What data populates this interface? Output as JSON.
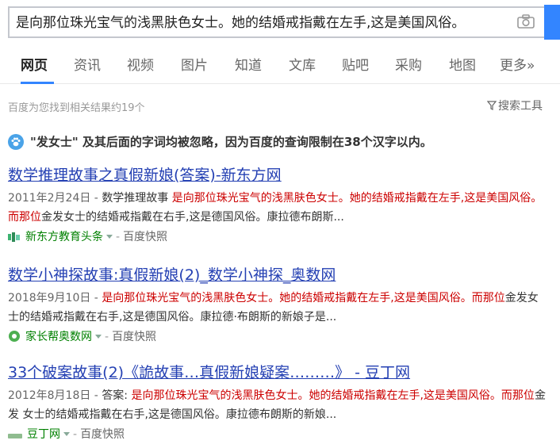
{
  "search": {
    "query": "是向那位珠光宝气的浅黑肤色女士。她的结婚戒指戴在左手,这是美国风俗。"
  },
  "tabs": [
    {
      "label": "网页"
    },
    {
      "label": "资讯"
    },
    {
      "label": "视频"
    },
    {
      "label": "图片"
    },
    {
      "label": "知道"
    },
    {
      "label": "文库"
    },
    {
      "label": "贴吧"
    },
    {
      "label": "采购"
    },
    {
      "label": "地图"
    },
    {
      "label": "更多»"
    }
  ],
  "result_count": "百度为您找到相关结果约19个",
  "search_tools": "搜索工具",
  "notice": "\"发女士\" 及其后面的字词均被忽略，因为百度的查询限制在38个汉字以内。",
  "results": [
    {
      "title": "数学推理故事之真假新娘(答案)-新东方网",
      "date": "2011年2月24日 - ",
      "pre": "数学推理故事 ",
      "hl1": "是向那位珠光宝气的浅黑肤色女士。她的结婚戒指戴在左手,这是美国风俗。而那位",
      "post": "金发女士的结婚戒指戴在右手,这是德国风俗。康拉德布朗斯...",
      "site": "新东方教育头条",
      "snapshot": "百度快照"
    },
    {
      "title": "数学小神探故事:真假新娘(2)_数学小神探_奥数网",
      "date": "2018年9月10日 - ",
      "pre": "",
      "hl1": "是向那位珠光宝气的浅黑肤色女士。她的结婚戒指戴在左手,这是美国风俗。而那位",
      "post": "金发女士的结婚戒指戴在右手,这是德国风俗。康拉德·布朗斯的新娘子是...",
      "site": "家长帮奥数网",
      "snapshot": "百度快照"
    },
    {
      "title": "33个破案故事(2)《詭故事…真假新娘疑案………》 - 豆丁网",
      "date": "2012年8月18日 - ",
      "pre": "答案: ",
      "hl1": "是向那位珠光宝气的浅黑肤色女士。她的结婚戒指戴在左手,这是美国风俗。而那位",
      "post": "金发 女士的结婚戒指戴在右手,这是德国风俗。康拉德布朗斯的新娘...",
      "site": "豆丁网",
      "snapshot": "百度快照"
    }
  ],
  "colors": {
    "accent": "#3385ff",
    "link": "#2440b3",
    "highlight": "#cc0000",
    "site": "#008000"
  }
}
